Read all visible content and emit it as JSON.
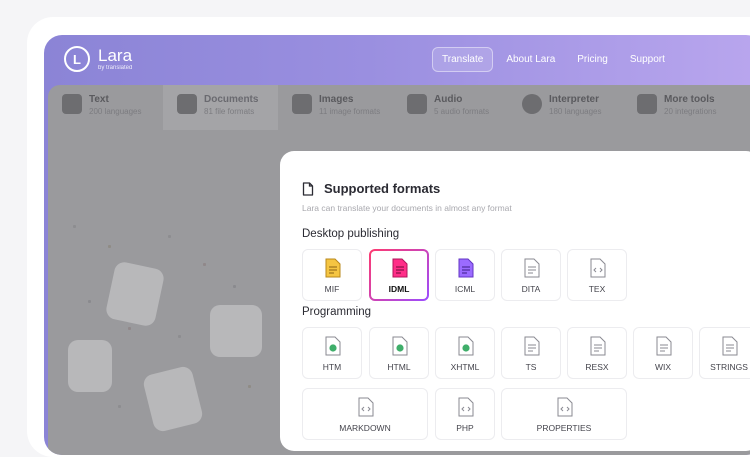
{
  "nav": {
    "logo_name": "Lara",
    "logo_sub": "by translated",
    "items": [
      {
        "label": "Translate",
        "active": true
      },
      {
        "label": "About Lara",
        "active": false
      },
      {
        "label": "Pricing",
        "active": false
      },
      {
        "label": "Support",
        "active": false
      }
    ]
  },
  "tabs": [
    {
      "title": "Text",
      "sub": "200 languages",
      "icon": "text-icon"
    },
    {
      "title": "Documents",
      "sub": "81 file formats",
      "icon": "document-icon"
    },
    {
      "title": "Images",
      "sub": "11 image formats",
      "icon": "image-icon"
    },
    {
      "title": "Audio",
      "sub": "5 audio formats",
      "icon": "audio-icon"
    },
    {
      "title": "Interpreter",
      "sub": "180 languages",
      "icon": "interpreter-icon"
    },
    {
      "title": "More tools",
      "sub": "20 integrations",
      "icon": "tools-icon"
    }
  ],
  "modal": {
    "title": "Supported formats",
    "subtitle": "Lara can translate your documents in almost any format",
    "sections": [
      {
        "name": "Desktop publishing",
        "formats": [
          {
            "label": "MIF",
            "color": "#f5c542"
          },
          {
            "label": "IDML",
            "color": "#ff2e88"
          },
          {
            "label": "ICML",
            "color": "#9b6bff"
          },
          {
            "label": "DITA",
            "color": "#9a9aa2"
          },
          {
            "label": "TEX",
            "color": "#9a9aa2"
          }
        ]
      },
      {
        "name": "Programming",
        "formats": [
          {
            "label": "HTM",
            "color": "#3fae6a"
          },
          {
            "label": "HTML",
            "color": "#3fae6a"
          },
          {
            "label": "XHTML",
            "color": "#3fae6a"
          },
          {
            "label": "TS",
            "color": "#9a9aa2"
          },
          {
            "label": "RESX",
            "color": "#9a9aa2"
          },
          {
            "label": "WIX",
            "color": "#9a9aa2"
          },
          {
            "label": "STRINGS",
            "color": "#9a9aa2"
          },
          {
            "label": "MARKDOWN",
            "color": "#9a9aa2"
          },
          {
            "label": "PHP",
            "color": "#9a9aa2"
          },
          {
            "label": "PROPERTIES",
            "color": "#9a9aa2"
          }
        ]
      }
    ]
  }
}
